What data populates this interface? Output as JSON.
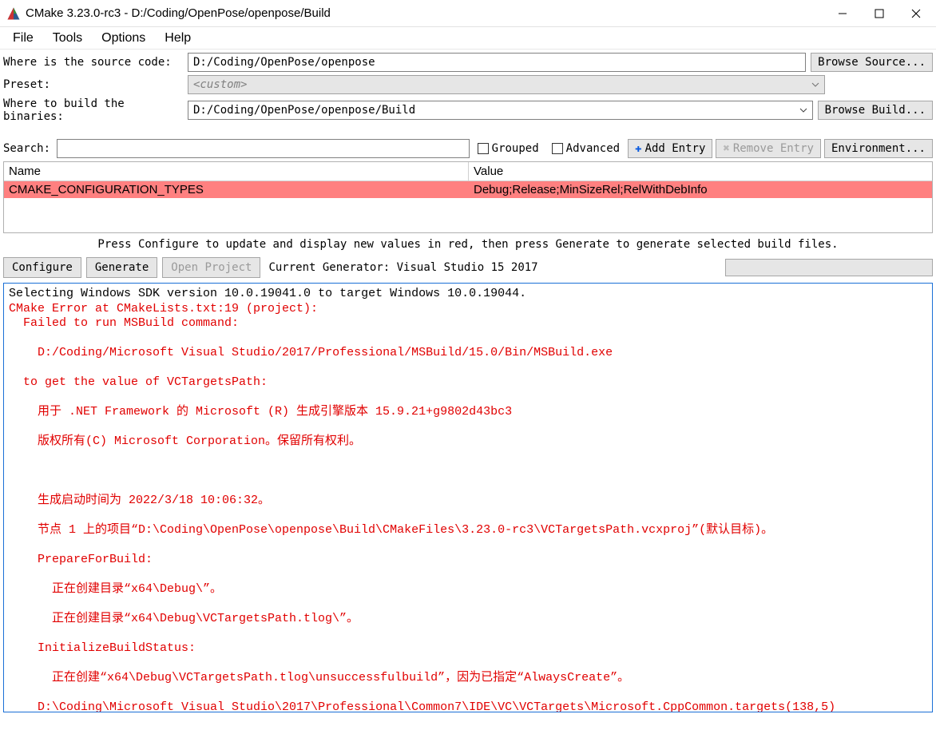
{
  "window": {
    "title": "CMake 3.23.0-rc3 - D:/Coding/OpenPose/openpose/Build"
  },
  "menu": {
    "file": "File",
    "tools": "Tools",
    "options": "Options",
    "help": "Help"
  },
  "form": {
    "source_label": "Where is the source code:",
    "source_value": "D:/Coding/OpenPose/openpose",
    "browse_source": "Browse Source...",
    "preset_label": "Preset:",
    "preset_value": "<custom>",
    "build_label": "Where to build the binaries:",
    "build_value": "D:/Coding/OpenPose/openpose/Build",
    "browse_build": "Browse Build..."
  },
  "options": {
    "search_label": "Search:",
    "search_value": "",
    "grouped_label": "Grouped",
    "advanced_label": "Advanced",
    "add_entry": "Add Entry",
    "remove_entry": "Remove Entry",
    "environment": "Environment..."
  },
  "table": {
    "col_name": "Name",
    "col_value": "Value",
    "rows": [
      {
        "name": "CMAKE_CONFIGURATION_TYPES",
        "value": "Debug;Release;MinSizeRel;RelWithDebInfo"
      }
    ]
  },
  "hint": "Press Configure to update and display new values in red, then press Generate to generate selected build files.",
  "actions": {
    "configure": "Configure",
    "generate": "Generate",
    "open_project": "Open Project",
    "generator": "Current Generator: Visual Studio 15 2017"
  },
  "output": {
    "lines": [
      {
        "cls": "norm",
        "text": "Selecting Windows SDK version 10.0.19041.0 to target Windows 10.0.19044."
      },
      {
        "cls": "err",
        "text": "CMake Error at CMakeLists.txt:19 (project):"
      },
      {
        "cls": "err",
        "text": "  Failed to run MSBuild command:"
      },
      {
        "cls": "err",
        "text": ""
      },
      {
        "cls": "err",
        "text": "    D:/Coding/Microsoft Visual Studio/2017/Professional/MSBuild/15.0/Bin/MSBuild.exe"
      },
      {
        "cls": "err",
        "text": ""
      },
      {
        "cls": "err",
        "text": "  to get the value of VCTargetsPath:"
      },
      {
        "cls": "err",
        "text": ""
      },
      {
        "cls": "err",
        "text": "    用于 .NET Framework 的 Microsoft (R) 生成引擎版本 15.9.21+g9802d43bc3"
      },
      {
        "cls": "err",
        "text": ""
      },
      {
        "cls": "err",
        "text": "    版权所有(C) Microsoft Corporation。保留所有权利。"
      },
      {
        "cls": "err",
        "text": ""
      },
      {
        "cls": "err",
        "text": ""
      },
      {
        "cls": "err",
        "text": ""
      },
      {
        "cls": "err",
        "text": "    生成启动时间为 2022/3/18 10:06:32。"
      },
      {
        "cls": "err",
        "text": ""
      },
      {
        "cls": "err",
        "text": "    节点 1 上的项目“D:\\Coding\\OpenPose\\openpose\\Build\\CMakeFiles\\3.23.0-rc3\\VCTargetsPath.vcxproj”(默认目标)。"
      },
      {
        "cls": "err",
        "text": ""
      },
      {
        "cls": "err",
        "text": "    PrepareForBuild:"
      },
      {
        "cls": "err",
        "text": ""
      },
      {
        "cls": "err",
        "text": "      正在创建目录“x64\\Debug\\”。"
      },
      {
        "cls": "err",
        "text": ""
      },
      {
        "cls": "err",
        "text": "      正在创建目录“x64\\Debug\\VCTargetsPath.tlog\\”。"
      },
      {
        "cls": "err",
        "text": ""
      },
      {
        "cls": "err",
        "text": "    InitializeBuildStatus:"
      },
      {
        "cls": "err",
        "text": ""
      },
      {
        "cls": "err",
        "text": "      正在创建“x64\\Debug\\VCTargetsPath.tlog\\unsuccessfulbuild”，因为已指定“AlwaysCreate”。"
      },
      {
        "cls": "err",
        "text": ""
      },
      {
        "cls": "err",
        "text": "    D:\\Coding\\Microsoft Visual Studio\\2017\\Professional\\Common7\\IDE\\VC\\VCTargets\\Microsoft.CppCommon.targets(138,5)"
      }
    ]
  }
}
